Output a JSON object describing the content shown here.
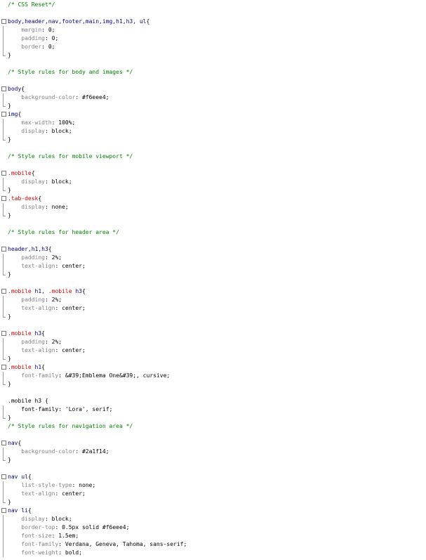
{
  "editor": {
    "lines": [
      {
        "type": "comment",
        "text": "/* CSS Reset*/"
      },
      {
        "type": "blank"
      },
      {
        "type": "selector",
        "text": "body,header,nav,footer,main,img,h1,h3, ul",
        "kind": "tag"
      },
      {
        "type": "rule",
        "prop": "margin",
        "value": "0;"
      },
      {
        "type": "rule",
        "prop": "padding",
        "value": "0;"
      },
      {
        "type": "rule",
        "prop": "border",
        "value": "0;"
      },
      {
        "type": "close"
      },
      {
        "type": "blank"
      },
      {
        "type": "comment",
        "text": "/* Style rules for body and images */"
      },
      {
        "type": "blank"
      },
      {
        "type": "selector",
        "text": "body",
        "kind": "tag"
      },
      {
        "type": "rule",
        "prop": "background-color",
        "value": "#f6eee4;"
      },
      {
        "type": "close"
      },
      {
        "type": "selector",
        "text": "img",
        "kind": "tag"
      },
      {
        "type": "rule",
        "prop": "max-width",
        "value": "100%;"
      },
      {
        "type": "rule",
        "prop": "display",
        "value": "block;"
      },
      {
        "type": "close"
      },
      {
        "type": "blank"
      },
      {
        "type": "comment",
        "text": "/* Style rules for mobile viewport */"
      },
      {
        "type": "blank"
      },
      {
        "type": "selector",
        "text": ".mobile",
        "kind": "class"
      },
      {
        "type": "rule",
        "prop": "display",
        "value": "block;"
      },
      {
        "type": "close"
      },
      {
        "type": "selector",
        "text": ".tab-desk",
        "kind": "class"
      },
      {
        "type": "rule",
        "prop": "display",
        "value": "none;"
      },
      {
        "type": "close"
      },
      {
        "type": "blank"
      },
      {
        "type": "comment",
        "text": "/* Style rules for header area */"
      },
      {
        "type": "blank"
      },
      {
        "type": "selector",
        "text": "header,h1,h3",
        "kind": "tag"
      },
      {
        "type": "rule",
        "prop": "padding",
        "value": "2%;"
      },
      {
        "type": "rule",
        "prop": "text-align",
        "value": "center;"
      },
      {
        "type": "close"
      },
      {
        "type": "blank"
      },
      {
        "type": "selector",
        "parts": [
          {
            "t": ".mobile",
            "k": "class"
          },
          {
            "t": " h1, ",
            "k": "tag"
          },
          {
            "t": ".mobile",
            "k": "class"
          },
          {
            "t": " h3",
            "k": "tag"
          }
        ]
      },
      {
        "type": "rule",
        "prop": "padding",
        "value": "2%;"
      },
      {
        "type": "rule",
        "prop": "text-align",
        "value": "center;"
      },
      {
        "type": "close"
      },
      {
        "type": "blank"
      },
      {
        "type": "selector",
        "parts": [
          {
            "t": ".mobile",
            "k": "class"
          },
          {
            "t": " h3",
            "k": "tag"
          }
        ]
      },
      {
        "type": "rule",
        "prop": "padding",
        "value": "2%;"
      },
      {
        "type": "rule",
        "prop": "text-align",
        "value": "center;"
      },
      {
        "type": "close"
      },
      {
        "type": "selector",
        "parts": [
          {
            "t": ".mobile",
            "k": "class"
          },
          {
            "t": " h1",
            "k": "tag"
          }
        ]
      },
      {
        "type": "rule",
        "prop": "font-family",
        "value": "&#39;Emblema One&#39;, cursive;"
      },
      {
        "type": "close"
      },
      {
        "type": "blank"
      },
      {
        "type": "plain-open",
        "text": ".mobile h3 {"
      },
      {
        "type": "rule-plain",
        "prop": "font-family",
        "value": "'Lora', serif;"
      },
      {
        "type": "close"
      },
      {
        "type": "comment",
        "text": "/* Style rules for navigation area */"
      },
      {
        "type": "blank"
      },
      {
        "type": "selector",
        "text": "nav",
        "kind": "tag"
      },
      {
        "type": "rule",
        "prop": "background-color",
        "value": "#2a1f14;"
      },
      {
        "type": "close"
      },
      {
        "type": "blank"
      },
      {
        "type": "selector",
        "text": "nav ul",
        "kind": "tag"
      },
      {
        "type": "rule",
        "prop": "list-style-type",
        "value": "none;"
      },
      {
        "type": "rule",
        "prop": "text-align",
        "value": "center;"
      },
      {
        "type": "close"
      },
      {
        "type": "selector",
        "text": "nav li",
        "kind": "tag"
      },
      {
        "type": "rule",
        "prop": "display",
        "value": "block;"
      },
      {
        "type": "rule",
        "prop": "border-top",
        "value": "0.5px solid #f6eee4;"
      },
      {
        "type": "rule",
        "prop": "font-size",
        "value": "1.5em;"
      },
      {
        "type": "rule",
        "prop": "font-family",
        "value": "Verdana, Geneva, Tahoma, sans-serif;"
      },
      {
        "type": "rule",
        "prop": "font-weight",
        "value": "bold;"
      }
    ]
  }
}
